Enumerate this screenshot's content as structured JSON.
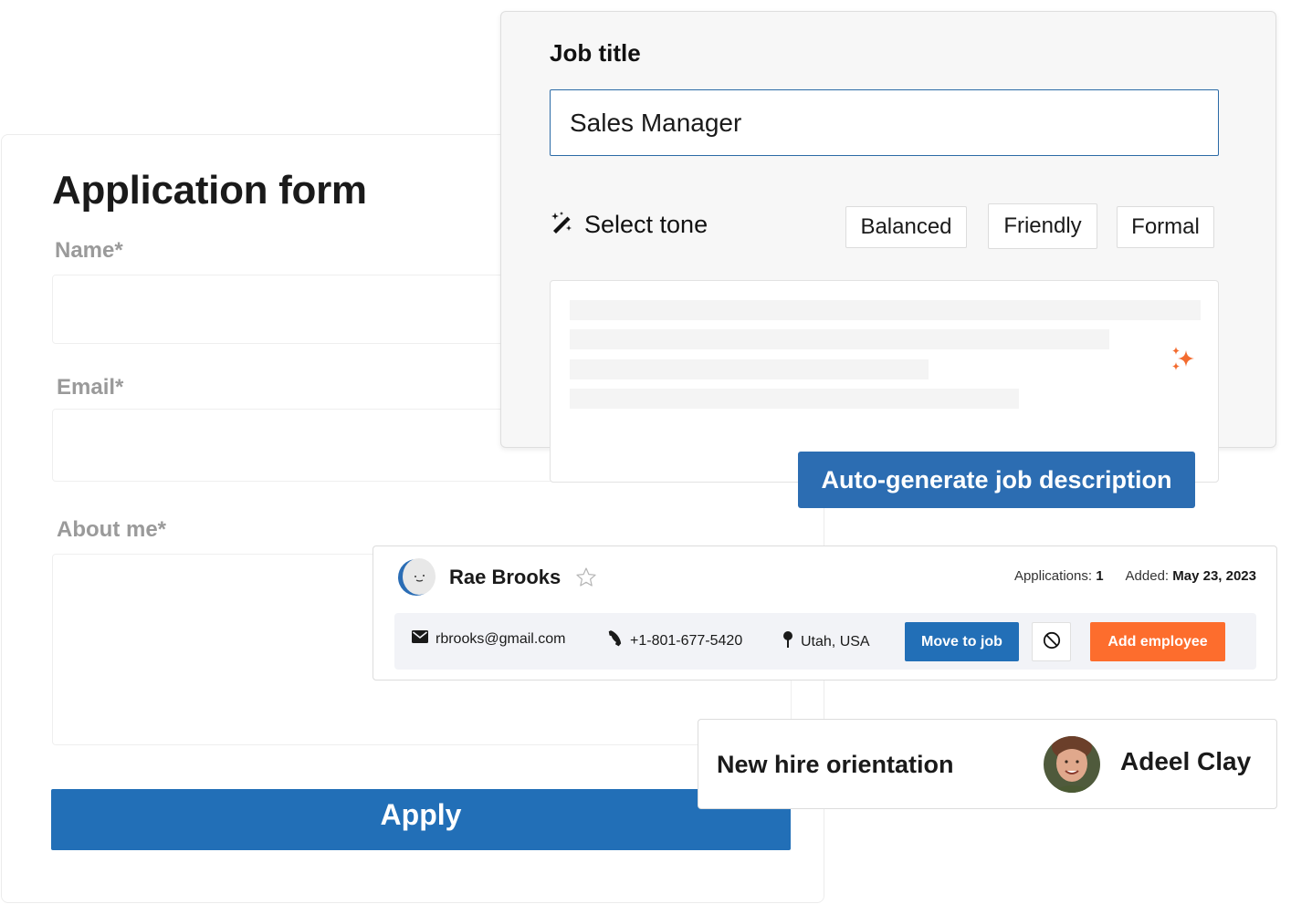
{
  "application_form": {
    "title": "Application form",
    "fields": [
      {
        "label": "Name*",
        "value": ""
      },
      {
        "label": "Email*",
        "value": ""
      },
      {
        "label": "About me*",
        "value": ""
      }
    ],
    "apply_label": "Apply"
  },
  "job_editor": {
    "job_title_label": "Job title",
    "job_title_value": "Sales Manager",
    "select_tone_label": "Select tone",
    "select_tone_icon": "magic-wand-icon",
    "tones": [
      "Balanced",
      "Friendly",
      "Formal"
    ],
    "description_icon": "sparkle-icon",
    "autogenerate_label": "Auto-generate job description"
  },
  "candidate": {
    "name": "Rae Brooks",
    "favorite_icon": "star-outline-icon",
    "applications_label": "Applications:",
    "applications_value": "1",
    "added_label": "Added:",
    "added_value": "May 23, 2023",
    "email": "rbrooks@gmail.com",
    "phone": "+1-801-677-5420",
    "location": "Utah, USA",
    "actions": {
      "move_to_job": "Move to job",
      "block_icon": "block-icon",
      "add_employee": "Add employee"
    }
  },
  "orientation": {
    "title": "New hire orientation",
    "person": "Adeel Clay"
  },
  "colors": {
    "primary_blue": "#226fb7",
    "accent_orange": "#fd6d2d",
    "label_gray": "#9a9a9a"
  }
}
